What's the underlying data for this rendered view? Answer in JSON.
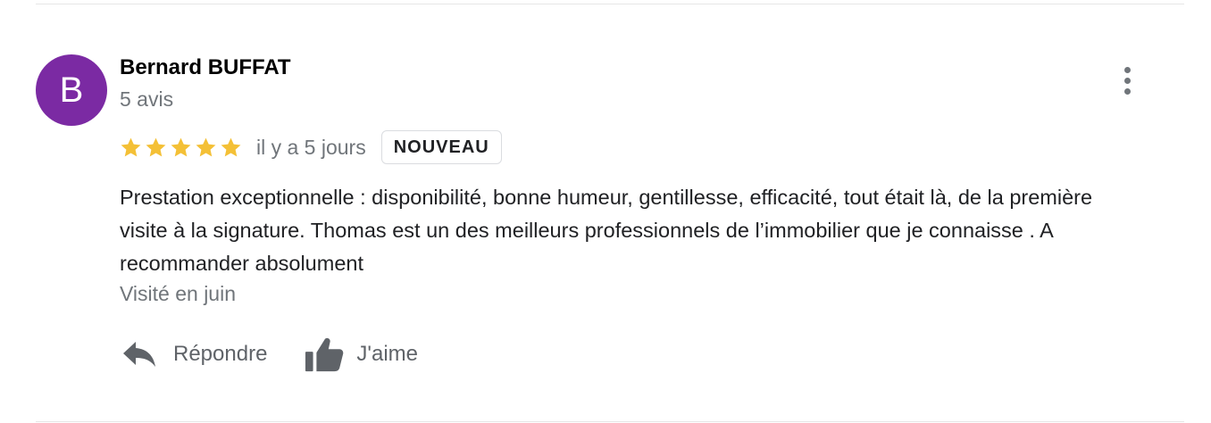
{
  "review": {
    "author": {
      "initial": "B",
      "name": "Bernard BUFFAT",
      "reviews_count": "5 avis",
      "avatar_color": "#7b2aa3"
    },
    "rating": 5,
    "rating_max": 5,
    "star_color": "#f4c036",
    "time_ago": "il y a 5 jours",
    "badge": "NOUVEAU",
    "text": "Prestation exceptionnelle : disponibilité, bonne humeur, gentillesse, efficacité, tout était là, de la première visite à la signature. Thomas est un des meilleurs professionnels de l’immobilier que je connaisse . A recommander absolument",
    "visited": "Visité en juin",
    "actions": {
      "reply_label": "Répondre",
      "reply_icon": "reply-icon",
      "like_label": "J'aime",
      "like_icon": "thumbs-up-icon"
    },
    "menu_icon": "more-vert-icon"
  }
}
